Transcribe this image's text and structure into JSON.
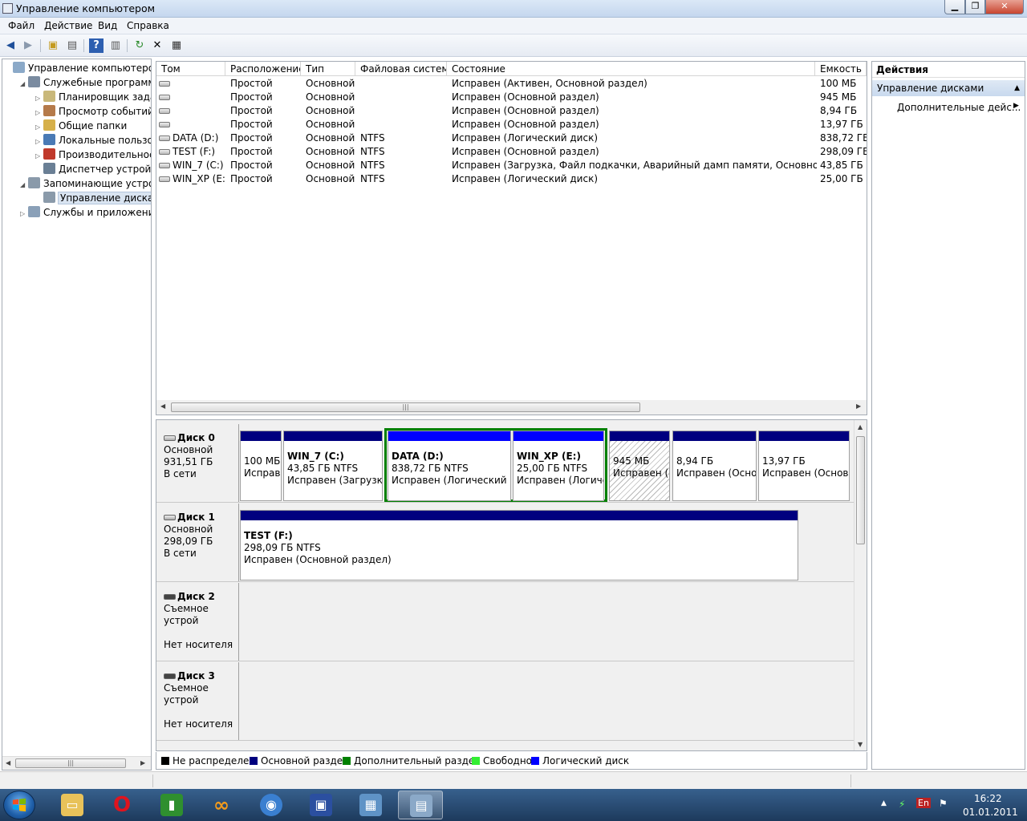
{
  "window": {
    "title": "Управление компьютером"
  },
  "menu": [
    "Файл",
    "Действие",
    "Вид",
    "Справка"
  ],
  "tree": {
    "items": [
      {
        "label": "Управление компьютером (л",
        "level": 0,
        "expander": "",
        "icon": "computer-management-icon"
      },
      {
        "label": "Служебные программы",
        "level": 1,
        "expander": "◢",
        "icon": "tools-icon"
      },
      {
        "label": "Планировщик заданий",
        "level": 2,
        "expander": "▷",
        "icon": "clock-icon"
      },
      {
        "label": "Просмотр событий",
        "level": 2,
        "expander": "▷",
        "icon": "event-viewer-icon"
      },
      {
        "label": "Общие папки",
        "level": 2,
        "expander": "▷",
        "icon": "shared-folder-icon"
      },
      {
        "label": "Локальные пользовате",
        "level": 2,
        "expander": "▷",
        "icon": "users-icon"
      },
      {
        "label": "Производительность",
        "level": 2,
        "expander": "▷",
        "icon": "performance-icon"
      },
      {
        "label": "Диспетчер устройств",
        "level": 2,
        "expander": "",
        "icon": "device-manager-icon"
      },
      {
        "label": "Запоминающие устройст",
        "level": 1,
        "expander": "◢",
        "icon": "storage-icon"
      },
      {
        "label": "Управление дисками",
        "level": 2,
        "expander": "",
        "icon": "disk-management-icon",
        "selected": true
      },
      {
        "label": "Службы и приложения",
        "level": 1,
        "expander": "▷",
        "icon": "services-icon"
      }
    ]
  },
  "volumes": {
    "columns": [
      "Том",
      "Расположение",
      "Тип",
      "Файловая система",
      "Состояние",
      "Емкость"
    ],
    "rows": [
      [
        "",
        "Простой",
        "Основной",
        "",
        "Исправен (Активен, Основной раздел)",
        "100 МБ"
      ],
      [
        "",
        "Простой",
        "Основной",
        "",
        "Исправен (Основной раздел)",
        "945 МБ"
      ],
      [
        "",
        "Простой",
        "Основной",
        "",
        "Исправен (Основной раздел)",
        "8,94 ГБ"
      ],
      [
        "",
        "Простой",
        "Основной",
        "",
        "Исправен (Основной раздел)",
        "13,97 ГБ"
      ],
      [
        "DATA (D:)",
        "Простой",
        "Основной",
        "NTFS",
        "Исправен (Логический диск)",
        "838,72 ГБ"
      ],
      [
        "TEST (F:)",
        "Простой",
        "Основной",
        "NTFS",
        "Исправен (Основной раздел)",
        "298,09 ГБ"
      ],
      [
        "WIN_7 (C:)",
        "Простой",
        "Основной",
        "NTFS",
        "Исправен (Загрузка, Файл подкачки, Аварийный дамп памяти, Основной раздел)",
        "43,85 ГБ"
      ],
      [
        "WIN_XP (E:)",
        "Простой",
        "Основной",
        "NTFS",
        "Исправен (Логический диск)",
        "25,00 ГБ"
      ]
    ]
  },
  "disks": [
    {
      "name": "Диск 0",
      "type": "Основной",
      "size": "931,51 ГБ",
      "status": "В сети",
      "partitions": [
        {
          "name": "",
          "size": "100 МБ",
          "status": "Исправен"
        },
        {
          "name": "WIN_7  (C:)",
          "size": "43,85 ГБ NTFS",
          "status": "Исправен (Загрузка, Файл подкачки, Аварийный дамп памяти, Основной раздел)"
        },
        {
          "name": "DATA  (D:)",
          "size": "838,72 ГБ NTFS",
          "status": "Исправен (Логический диск)"
        },
        {
          "name": "WIN_XP  (E:)",
          "size": "25,00 ГБ NTFS",
          "status": "Исправен (Логический диск)"
        },
        {
          "name": "",
          "size": "945 МБ",
          "status": "Исправен (Основной раздел)"
        },
        {
          "name": "",
          "size": "8,94 ГБ",
          "status": "Исправен (Основной раздел)"
        },
        {
          "name": "",
          "size": "13,97 ГБ",
          "status": "Исправен (Основной раздел)"
        }
      ]
    },
    {
      "name": "Диск 1",
      "type": "Основной",
      "size": "298,09 ГБ",
      "status": "В сети",
      "partitions": [
        {
          "name": "TEST  (F:)",
          "size": "298,09 ГБ NTFS",
          "status": "Исправен (Основной раздел)"
        }
      ]
    },
    {
      "name": "Диск 2",
      "type": "Съемное устрой",
      "size": "",
      "status": "Нет носителя",
      "partitions": []
    },
    {
      "name": "Диск 3",
      "type": "Съемное устрой",
      "size": "",
      "status": "Нет носителя",
      "partitions": []
    }
  ],
  "legend": [
    {
      "label": "Не распределен",
      "color": "#000000"
    },
    {
      "label": "Основной раздел",
      "color": "#00007f"
    },
    {
      "label": "Дополнительный раздел",
      "color": "#008000"
    },
    {
      "label": "Свободно",
      "color": "#33ee33"
    },
    {
      "label": "Логический диск",
      "color": "#0000ff"
    }
  ],
  "actions": {
    "header": "Действия",
    "section": "Управление дисками",
    "more": "Дополнительные дейс..."
  },
  "tray": {
    "lang": "En",
    "time": "16:22",
    "date": "01.01.2011"
  },
  "colors": {
    "primary": "#00007f",
    "logical": "#0000ff",
    "extended": "#008000"
  }
}
